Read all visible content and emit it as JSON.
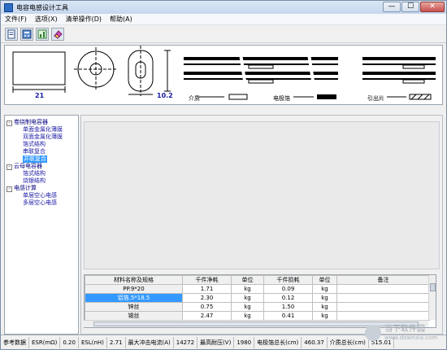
{
  "window": {
    "title": "电容电感设计工具",
    "close_glyph": "✕",
    "min_glyph": "—",
    "max_glyph": "☐"
  },
  "menu": [
    "文件(F)",
    "选项(X)",
    "清单操作(D)",
    "帮助(A)"
  ],
  "toolbar_icons": [
    "document-icon",
    "calculator-icon",
    "chart-icon",
    "eraser-icon"
  ],
  "diagram": {
    "dim_width": "21",
    "dim_height": "10.2",
    "legend": {
      "dielectric": "介质",
      "electrode_foil": "电极箔",
      "lead": "引出片"
    }
  },
  "tree": [
    {
      "label": "卷绕制电容器",
      "toggle": "-",
      "children": [
        "单面金属化薄膜",
        "双面金属化薄膜",
        "箔式结构",
        "串联复合",
        "并联复合"
      ]
    },
    {
      "label": "云母电容器",
      "toggle": "-",
      "children": [
        "箔式结构",
        "烧银结构"
      ]
    },
    {
      "label": "电感计算",
      "toggle": "-",
      "children": [
        "单层空心电感",
        "多层空心电感"
      ]
    }
  ],
  "selected_tree_item": "并联复合",
  "table": {
    "headers": [
      "材料名称及规格",
      "千件净耗",
      "单位",
      "千件损耗",
      "单位",
      "备注"
    ],
    "rows": [
      [
        "PP.9*20",
        "1.71",
        "kg",
        "0.09",
        "kg",
        ""
      ],
      [
        "铝箔.5*18.5",
        "2.30",
        "kg",
        "0.12",
        "kg",
        ""
      ],
      [
        "锌丝",
        "0.75",
        "kg",
        "1.50",
        "kg",
        ""
      ],
      [
        "锡丝",
        "2.47",
        "kg",
        "0.41",
        "kg",
        ""
      ]
    ]
  },
  "status": [
    "参考数据",
    "ESR(mΩ)",
    "0.20",
    "ESL(nH)",
    "2.71",
    "最大冲击电流(A)",
    "14272",
    "最高耐压(V)",
    "1980",
    "电极箔总长(cm)",
    "460.37",
    "介质总长(cm)",
    "515.01"
  ],
  "watermark": {
    "name": "当下软件园",
    "url": "www.downxia.com"
  }
}
